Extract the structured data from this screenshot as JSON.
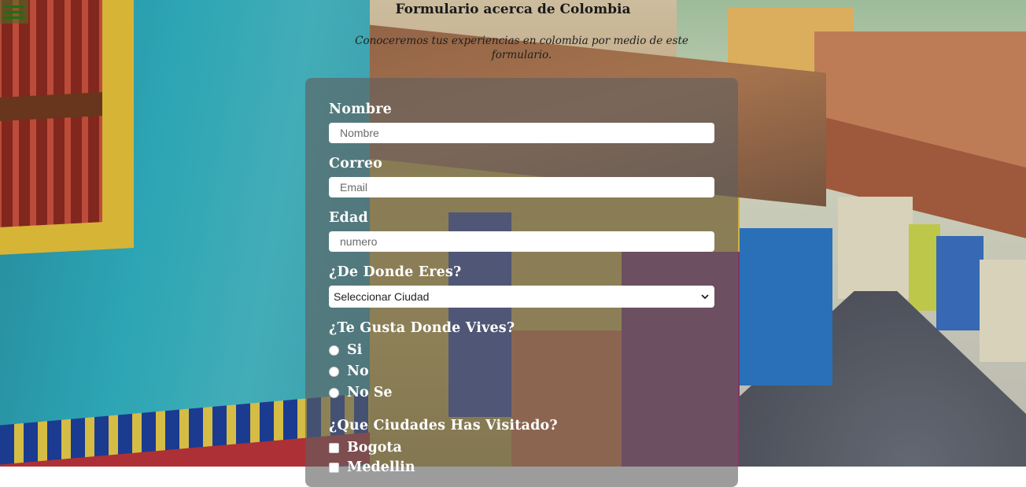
{
  "header": {
    "menu_icon": "hamburger-menu-icon",
    "title": "Formulario acerca de Colombia",
    "subtitle": "Conoceremos tus experiencias en colombia por medio de este formulario."
  },
  "form": {
    "nombre_label": "Nombre",
    "nombre_placeholder": "Nombre",
    "correo_label": "Correo",
    "correo_placeholder": "Email",
    "edad_label": "Edad",
    "edad_placeholder": "numero",
    "origen_label": "¿De Donde Eres?",
    "origen_selected": "Seleccionar Ciudad",
    "gusta_label": "¿Te Gusta Donde Vives?",
    "gusta_options": [
      "Si",
      "No",
      "No Se"
    ],
    "ciudades_label": "¿Que Ciudades Has Visitado?",
    "ciudades_options": [
      "Bogota",
      "Medellin"
    ]
  },
  "colors": {
    "menu_icon": "#1f6f13",
    "card_bg": "rgba(95,95,95,0.62)",
    "label_text": "#ffffff"
  }
}
